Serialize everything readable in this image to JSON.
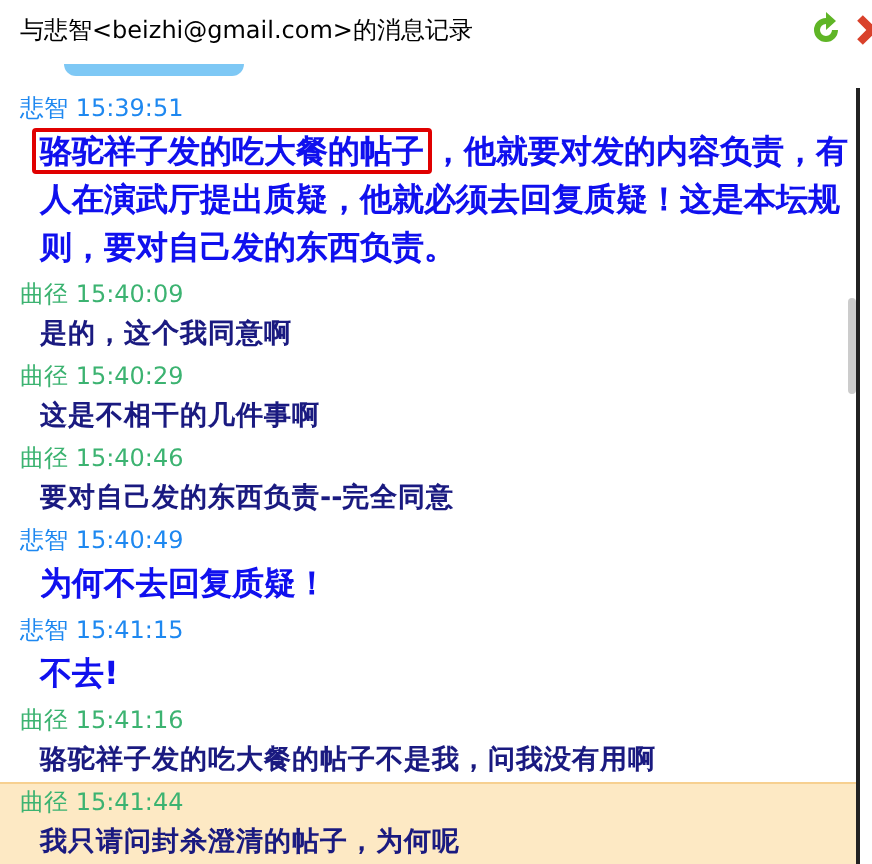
{
  "window": {
    "title": "与悲智<beizhi@gmail.com>的消息记录"
  },
  "messages": [
    {
      "sender": "悲智",
      "time": "15:39:51",
      "kind": "large",
      "selected": false,
      "highlight": "骆驼祥子发的吃大餐的帖子",
      "text": "，他就要对发的内容负责，有人在演武厅提出质疑，他就必须去回复质疑！这是本坛规则，要对自己发的东西负责。"
    },
    {
      "sender": "曲径",
      "time": "15:40:09",
      "kind": "normal",
      "selected": false,
      "text": "是的，这个我同意啊"
    },
    {
      "sender": "曲径",
      "time": "15:40:29",
      "kind": "normal",
      "selected": false,
      "text": "这是不相干的几件事啊"
    },
    {
      "sender": "曲径",
      "time": "15:40:46",
      "kind": "normal",
      "selected": false,
      "text": "要对自己发的东西负责--完全同意"
    },
    {
      "sender": "悲智",
      "time": "15:40:49",
      "kind": "large",
      "selected": false,
      "text": "为何不去回复质疑！"
    },
    {
      "sender": "悲智",
      "time": "15:41:15",
      "kind": "large",
      "selected": false,
      "text": "不去!"
    },
    {
      "sender": "曲径",
      "time": "15:41:16",
      "kind": "normal",
      "selected": false,
      "text": "骆驼祥子发的吃大餐的帖子不是我，问我没有用啊"
    },
    {
      "sender": "曲径",
      "time": "15:41:44",
      "kind": "normal",
      "selected": true,
      "text": "我只请问封杀澄清的帖子，为何呢"
    }
  ]
}
